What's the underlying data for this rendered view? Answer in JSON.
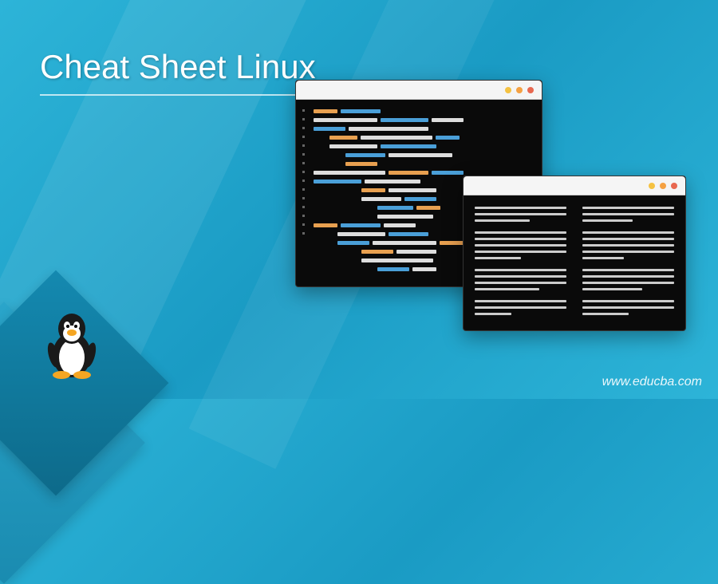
{
  "title": "Cheat Sheet Linux",
  "watermark": "www.educba.com",
  "terminal1": {
    "name": "code-editor-window"
  },
  "terminal2": {
    "name": "text-document-window"
  },
  "mascot": "tux-penguin"
}
